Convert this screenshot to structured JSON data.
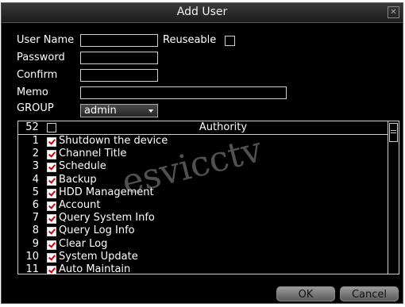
{
  "dialog": {
    "title": "Add User"
  },
  "form": {
    "user_name_label": "User Name",
    "reuseable_label": "Reuseable",
    "password_label": "Password",
    "confirm_label": "Confirm",
    "memo_label": "Memo",
    "group_label": "GROUP",
    "group_value": "admin"
  },
  "authority": {
    "count": "52",
    "header": "Authority",
    "items": [
      {
        "num": "1",
        "label": "Shutdown the device"
      },
      {
        "num": "2",
        "label": "Channel Title"
      },
      {
        "num": "3",
        "label": "Schedule"
      },
      {
        "num": "4",
        "label": "Backup"
      },
      {
        "num": "5",
        "label": "HDD Management"
      },
      {
        "num": "6",
        "label": "Account"
      },
      {
        "num": "7",
        "label": "Query System Info"
      },
      {
        "num": "8",
        "label": "Query Log Info"
      },
      {
        "num": "9",
        "label": "Clear Log"
      },
      {
        "num": "10",
        "label": "System Update"
      },
      {
        "num": "11",
        "label": "Auto Maintain"
      }
    ]
  },
  "buttons": {
    "ok": "OK",
    "cancel": "Cancel"
  },
  "watermark": "esvicctv"
}
